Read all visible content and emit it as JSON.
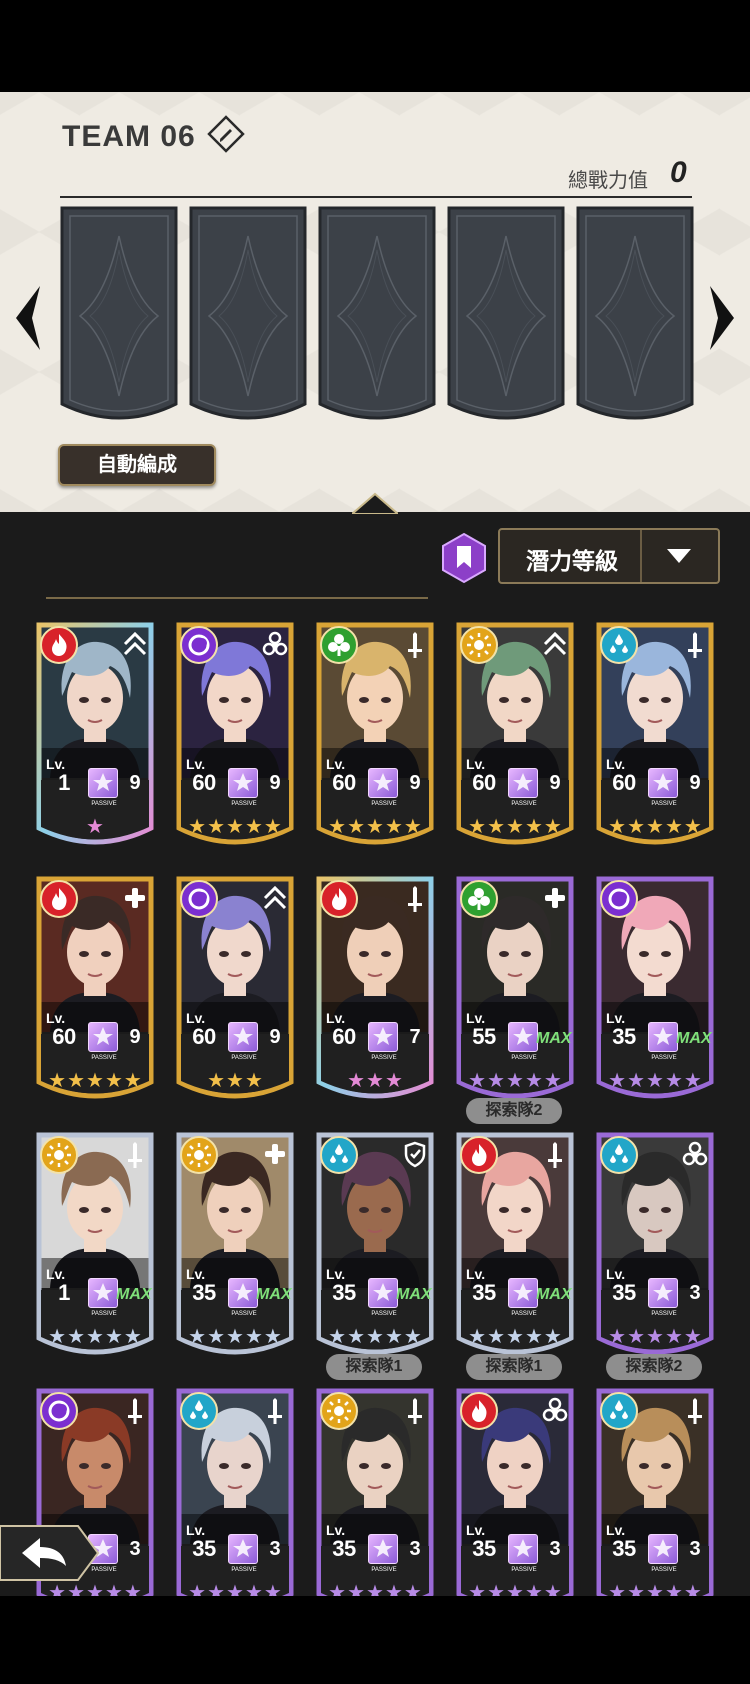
{
  "team": {
    "title": "TEAM 06",
    "power_label": "總戰力值",
    "power_value": "0",
    "auto_button": "自動編成",
    "slot_count": 5
  },
  "sort": {
    "selected": "潛力等級"
  },
  "colors": {
    "fire": "#d8222a",
    "dark": "#7b2fd0",
    "wind": "#2fa030",
    "light": "#e2a41a",
    "water": "#22a6c8",
    "gold_frame": "#d9a436",
    "rainbow_frame": "#c9b46a",
    "purple_frame": "#9a6ad6",
    "silver_frame": "#b9c3d6"
  },
  "cards": [
    {
      "attr": "fire",
      "role": "up-arrow-icon",
      "frame": "rainbow",
      "level": "1",
      "passive": "9",
      "stars": 1,
      "star_color": "rainbow",
      "hair": "#9fb6c8",
      "skin": "#f0d6c8",
      "bg": "#2a3a44"
    },
    {
      "attr": "dark",
      "role": "biohazard-icon",
      "frame": "gold",
      "level": "60",
      "passive": "9",
      "stars": 5,
      "star_color": "gold",
      "hair": "#7f78d8",
      "skin": "#f2d7c8",
      "bg": "#2b2340"
    },
    {
      "attr": "wind",
      "role": "sword-icon",
      "frame": "gold",
      "level": "60",
      "passive": "9",
      "stars": 5,
      "star_color": "gold",
      "hair": "#d9b46c",
      "skin": "#f3d2b6",
      "bg": "#5a4a34"
    },
    {
      "attr": "light",
      "role": "up-arrow-icon",
      "frame": "gold",
      "level": "60",
      "passive": "9",
      "stars": 5,
      "star_color": "gold",
      "hair": "#6f9a7a",
      "skin": "#f1d7c6",
      "bg": "#3a3a3a"
    },
    {
      "attr": "water",
      "role": "sword-icon",
      "frame": "gold",
      "level": "60",
      "passive": "9",
      "stars": 5,
      "star_color": "gold",
      "hair": "#9ab6dc",
      "skin": "#f1dbd0",
      "bg": "#33405a"
    },
    {
      "attr": "fire",
      "role": "cross-icon",
      "frame": "gold",
      "level": "60",
      "passive": "9",
      "stars": 5,
      "star_color": "gold",
      "hair": "#3a2a26",
      "skin": "#f0d0be",
      "bg": "#5a2a22"
    },
    {
      "attr": "dark",
      "role": "up-arrow-icon",
      "frame": "gold",
      "level": "60",
      "passive": "9",
      "stars": 3,
      "star_color": "gold",
      "hair": "#8a82d0",
      "skin": "#f0d8cc",
      "bg": "#2a2a34"
    },
    {
      "attr": "fire",
      "role": "sword-icon",
      "frame": "rainbow",
      "level": "60",
      "passive": "7",
      "stars": 3,
      "star_color": "rainbow",
      "hair": "#3a2a22",
      "skin": "#efcfb8",
      "bg": "#3a2a20"
    },
    {
      "attr": "wind",
      "role": "cross-icon",
      "frame": "purple",
      "level": "55",
      "passive": "MAX",
      "stars": 5,
      "star_color": "purple",
      "hair": "#2e2a2a",
      "skin": "#ead2c4",
      "bg": "#2a2a26",
      "team": "探索隊2"
    },
    {
      "attr": "dark",
      "role": "none",
      "frame": "purple",
      "level": "35",
      "passive": "MAX",
      "stars": 5,
      "star_color": "purple",
      "hair": "#f0a8b8",
      "skin": "#f3dbd0",
      "bg": "#3a2a30"
    },
    {
      "attr": "light",
      "role": "sword-icon",
      "frame": "silver",
      "level": "1",
      "passive": "MAX",
      "stars": 5,
      "star_color": "silver",
      "hair": "#8a6a52",
      "skin": "#f2d8c6",
      "bg": "#d8d8d8"
    },
    {
      "attr": "light",
      "role": "cross-icon",
      "frame": "silver",
      "level": "35",
      "passive": "MAX",
      "stars": 5,
      "star_color": "silver",
      "hair": "#3a2822",
      "skin": "#efd0bc",
      "bg": "#a08a6a"
    },
    {
      "attr": "water",
      "role": "shield-icon",
      "frame": "silver",
      "level": "35",
      "passive": "MAX",
      "stars": 5,
      "star_color": "silver",
      "hair": "#5a3a52",
      "skin": "#9a6a4e",
      "bg": "#2a2a2a",
      "team": "探索隊1"
    },
    {
      "attr": "fire",
      "role": "sword-icon",
      "frame": "silver",
      "level": "35",
      "passive": "MAX",
      "stars": 5,
      "star_color": "silver",
      "hair": "#e8a6a0",
      "skin": "#f2d6c8",
      "bg": "#4a3a3a",
      "team": "探索隊1"
    },
    {
      "attr": "water",
      "role": "biohazard-icon",
      "frame": "purple",
      "level": "35",
      "passive": "3",
      "stars": 5,
      "star_color": "purple",
      "hair": "#2a2a2a",
      "skin": "#d8c8c0",
      "bg": "#3a3a3a",
      "team": "探索隊2"
    },
    {
      "attr": "dark",
      "role": "sword-icon",
      "frame": "purple",
      "level": "",
      "passive": "3",
      "stars": 5,
      "star_color": "purple",
      "hair": "#8a3a26",
      "skin": "#c88a6a",
      "bg": "#3a2622"
    },
    {
      "attr": "water",
      "role": "sword-icon",
      "frame": "purple",
      "level": "35",
      "passive": "3",
      "stars": 5,
      "star_color": "purple",
      "hair": "#c8d0dc",
      "skin": "#e8d4cc",
      "bg": "#3a4450"
    },
    {
      "attr": "light",
      "role": "sword-icon",
      "frame": "purple",
      "level": "35",
      "passive": "3",
      "stars": 5,
      "star_color": "purple",
      "hair": "#2a2a2a",
      "skin": "#ead2c2",
      "bg": "#34342e"
    },
    {
      "attr": "fire",
      "role": "biohazard-icon",
      "frame": "purple",
      "level": "35",
      "passive": "3",
      "stars": 5,
      "star_color": "purple",
      "hair": "#3a3a7a",
      "skin": "#efd2c4",
      "bg": "#2a2a38"
    },
    {
      "attr": "water",
      "role": "sword-icon",
      "frame": "purple",
      "level": "35",
      "passive": "3",
      "stars": 5,
      "star_color": "purple",
      "hair": "#b88e5a",
      "skin": "#e8c8ac",
      "bg": "#3a3026"
    }
  ],
  "lv_label": "Lv.",
  "passive_label": "PASSIVE"
}
